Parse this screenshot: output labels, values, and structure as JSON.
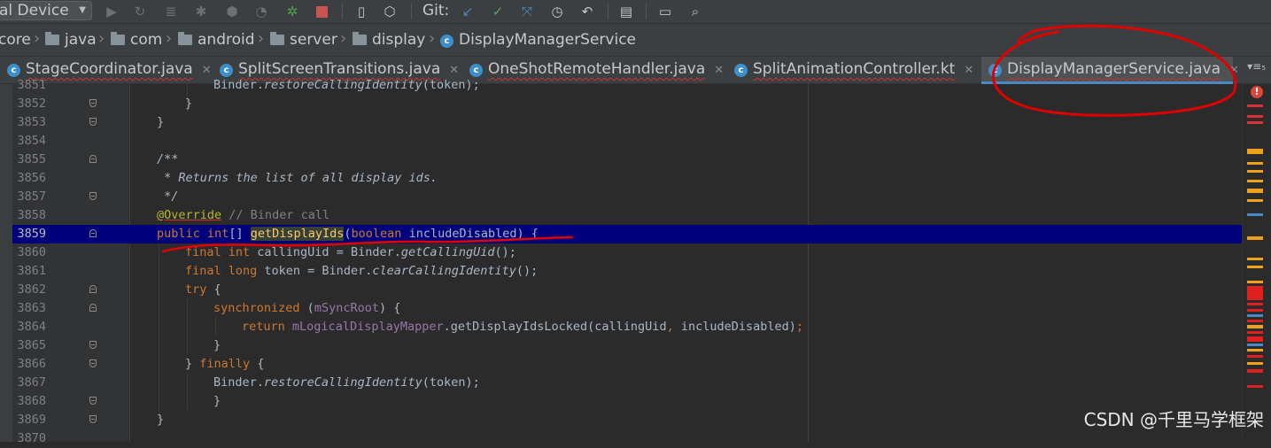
{
  "toolbar": {
    "device_label": "al Device",
    "git_label": "Git:",
    "icons": [
      "run-icon",
      "restart-icon",
      "profiler-icon",
      "debug-icon",
      "attach-icon",
      "dashboard-icon",
      "apply-changes-icon",
      "stop-icon",
      "device-manager-icon",
      "sdk-manager-icon",
      "git-update-icon",
      "git-commit-icon",
      "git-push-icon",
      "history-icon",
      "rollback-icon",
      "project-structure-icon",
      "terminal-icon",
      "search-icon"
    ]
  },
  "breadcrumb": {
    "items": [
      "core",
      "java",
      "com",
      "android",
      "server",
      "display",
      "DisplayManagerService"
    ]
  },
  "tabs": [
    {
      "label": "StageCoordinator.java",
      "close": "✕"
    },
    {
      "label": "SplitScreenTransitions.java",
      "close": "✕"
    },
    {
      "label": "OneShotRemoteHandler.java",
      "close": "✕"
    },
    {
      "label": "SplitAnimationController.kt",
      "close": "✕"
    },
    {
      "label": "DisplayManagerService.java",
      "close": "✕"
    }
  ],
  "tab_overflow": "▾≡₅",
  "editor": {
    "line_numbers": [
      "3851",
      "3852",
      "3853",
      "3854",
      "3855",
      "3856",
      "3857",
      "3858",
      "3859",
      "3860",
      "3861",
      "3862",
      "3863",
      "3864",
      "3865",
      "3866",
      "3867",
      "3868",
      "3869",
      "3870"
    ],
    "highlighted_line": "3859",
    "code": {
      "l3851": {
        "recv": "Binder.",
        "method": "restoreCallingIdentity",
        "args": "(token);"
      },
      "l3852": "}",
      "l3853": "}",
      "l3855": "/**",
      "l3856": " * Returns the list of all display ids.",
      "l3857": " */",
      "l3858": {
        "annotation": "@Override",
        "comment": "// Binder call"
      },
      "l3859": {
        "mod": "public",
        "type": "int",
        "brackets": "[]",
        "name": "getDisplayIds",
        "open": "(",
        "ptype": "boolean",
        "param": " includeDisabled) {"
      },
      "l3860": {
        "kw": "final int",
        "rest": " callingUid = Binder.",
        "method": "getCallingUid",
        "end": "();"
      },
      "l3861": {
        "kw": "final long",
        "rest": " token = Binder.",
        "method": "clearCallingIdentity",
        "end": "();"
      },
      "l3862": {
        "kw": "try",
        "rest": " {"
      },
      "l3863": {
        "kw": "synchronized",
        "open": " (",
        "field": "mSyncRoot",
        "end": ") {"
      },
      "l3864": {
        "kw": "return",
        "field": "mLogicalDisplayMapper",
        "rest": ".getDisplayIdsLocked(callingUid",
        "comma": ",",
        "arg": " includeDisabled)",
        "semi": ";"
      },
      "l3865": "}",
      "l3866": {
        "close": "} ",
        "kw": "finally",
        "rest": " {"
      },
      "l3867": {
        "recv": "Binder.",
        "method": "restoreCallingIdentity",
        "args": "(token);"
      },
      "l3868": "}",
      "l3869": "}"
    }
  },
  "markers": {
    "error_indicator": "!"
  },
  "watermark": "CSDN @千里马学框架",
  "colors": {
    "keyword": "#cc7832",
    "comment": "#629755",
    "annotation": "#bbb529",
    "method": "#ffc66d",
    "field": "#9876aa",
    "highlight": "#00007a",
    "annotation_ink": "#e00000"
  }
}
